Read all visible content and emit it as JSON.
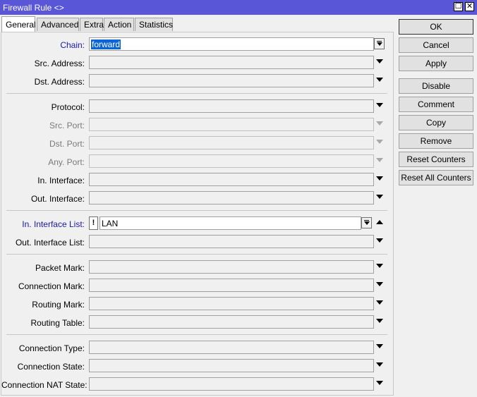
{
  "window": {
    "title": "Firewall Rule <>"
  },
  "title_buttons": {
    "maximize": "☐",
    "close": "✕"
  },
  "tabs": [
    "General",
    "Advanced",
    "Extra",
    "Action",
    "Statistics"
  ],
  "fields": {
    "chain": {
      "label": "Chain:",
      "value": "forward"
    },
    "src_address": {
      "label": "Src. Address:"
    },
    "dst_address": {
      "label": "Dst. Address:"
    },
    "protocol": {
      "label": "Protocol:"
    },
    "src_port": {
      "label": "Src. Port:"
    },
    "dst_port": {
      "label": "Dst. Port:"
    },
    "any_port": {
      "label": "Any. Port:"
    },
    "in_interface": {
      "label": "In. Interface:"
    },
    "out_interface": {
      "label": "Out. Interface:"
    },
    "in_interface_list": {
      "label": "In. Interface List:",
      "negate": "!",
      "value": "LAN"
    },
    "out_interface_list": {
      "label": "Out. Interface List:"
    },
    "packet_mark": {
      "label": "Packet Mark:"
    },
    "connection_mark": {
      "label": "Connection Mark:"
    },
    "routing_mark": {
      "label": "Routing Mark:"
    },
    "routing_table": {
      "label": "Routing Table:"
    },
    "connection_type": {
      "label": "Connection Type:"
    },
    "connection_state": {
      "label": "Connection State:"
    },
    "connection_nat_state": {
      "label": "Connection NAT State:"
    }
  },
  "buttons": {
    "ok": "OK",
    "cancel": "Cancel",
    "apply": "Apply",
    "disable": "Disable",
    "comment": "Comment",
    "copy": "Copy",
    "remove": "Remove",
    "reset_counters": "Reset Counters",
    "reset_all_counters": "Reset All Counters"
  },
  "colors": {
    "titlebar": "#5a56d8",
    "highlight_label": "#1a1aa6",
    "selection": "#0a64d6"
  }
}
